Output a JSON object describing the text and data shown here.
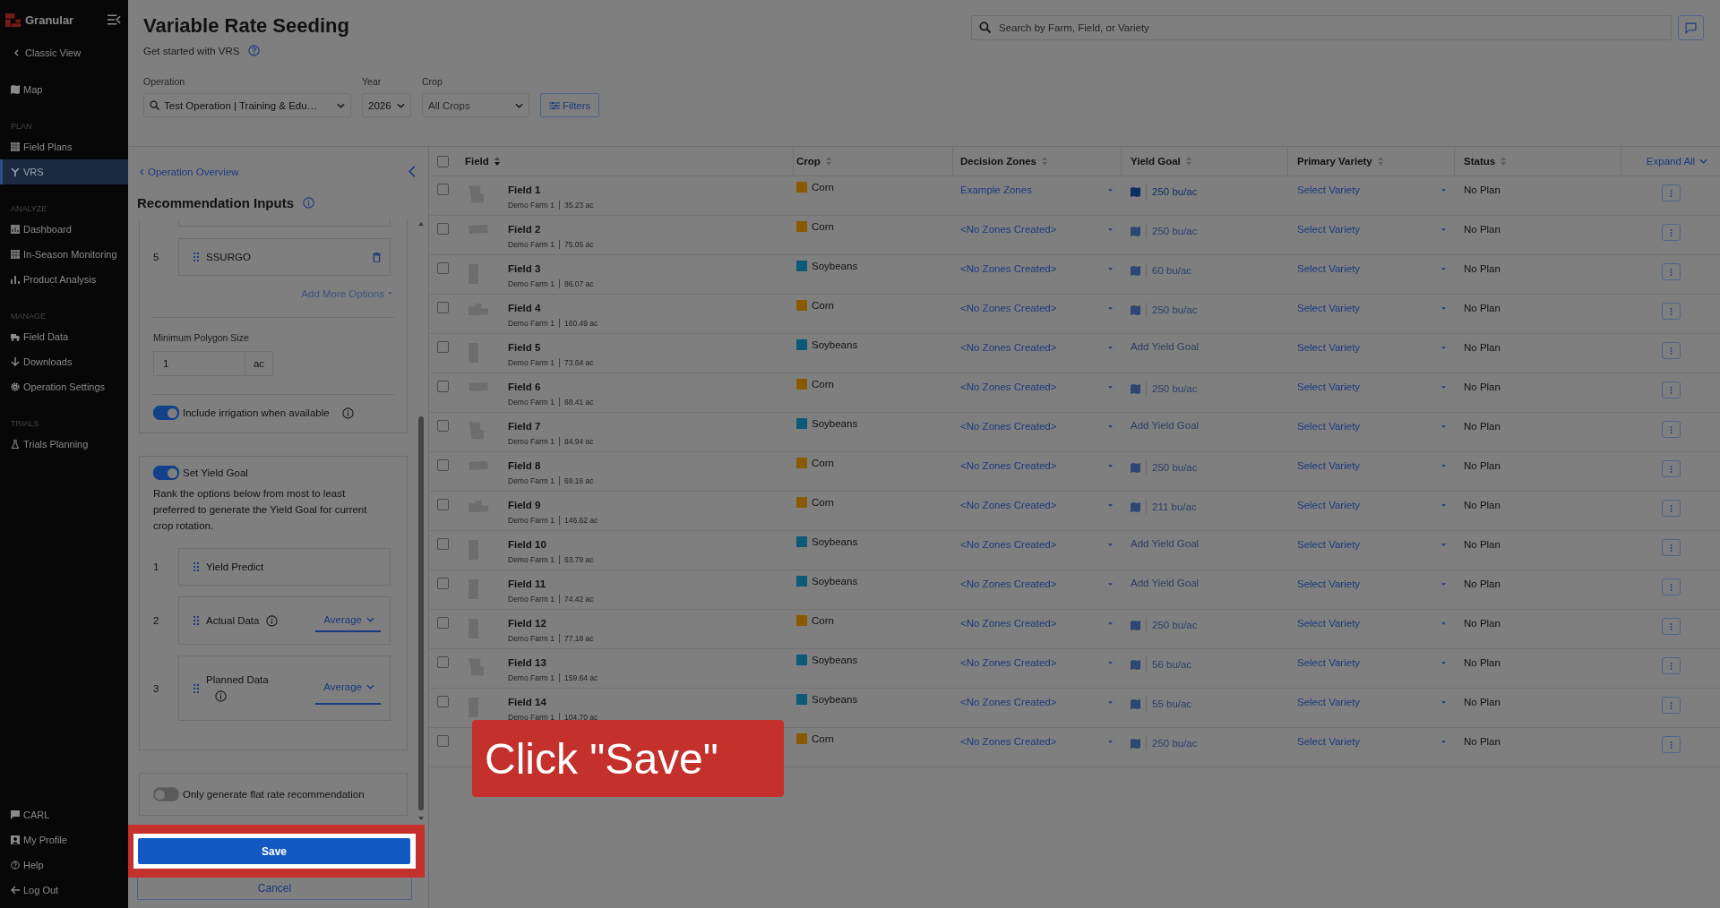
{
  "sidebar": {
    "brand": "Granular",
    "back_link": "Classic View",
    "groups": [
      {
        "items": [
          {
            "label": "Map",
            "selected": false
          }
        ]
      },
      {
        "heading": "PLAN",
        "items": [
          {
            "label": "Field Plans",
            "selected": false
          },
          {
            "label": "VRS",
            "selected": true
          }
        ]
      },
      {
        "heading": "ANALYZE",
        "items": [
          {
            "label": "Dashboard",
            "selected": false
          },
          {
            "label": "In-Season Monitoring",
            "selected": false
          },
          {
            "label": "Product Analysis",
            "selected": false
          }
        ]
      },
      {
        "heading": "MANAGE",
        "items": [
          {
            "label": "Field Data",
            "selected": false
          },
          {
            "label": "Downloads",
            "selected": false
          },
          {
            "label": "Operation Settings",
            "selected": false
          }
        ]
      },
      {
        "heading": "TRIALS",
        "items": [
          {
            "label": "Trials Planning",
            "selected": false
          }
        ]
      }
    ],
    "bottom_items": [
      "CARL",
      "My Profile",
      "Help",
      "Log Out"
    ]
  },
  "page": {
    "title": "Variable Rate Seeding",
    "subtitle": "Get started with VRS",
    "search_placeholder": "Search by Farm, Field, or Variety",
    "filters": [
      {
        "label": "Operation",
        "value": "Test Operation | Training & Edu…",
        "kind": "search"
      },
      {
        "label": "Year",
        "value": "2026",
        "kind": "select"
      },
      {
        "label": "Crop",
        "value": "All Crops",
        "kind": "select"
      }
    ],
    "filters_button": "Filters"
  },
  "panel": {
    "back_link": "Operation Overview",
    "title": "Recommendation Inputs",
    "sources": [
      {
        "rank": "5",
        "name": "SSURGO"
      }
    ],
    "add_more": "Add More Options",
    "min_polygon": {
      "label": "Minimum Polygon Size",
      "value": "1",
      "unit": "ac"
    },
    "irrigation": {
      "label": "Include irrigation when available",
      "on": true
    },
    "yield_goal": {
      "label": "Set Yield Goal",
      "on": true,
      "description": "Rank the options below from most to least preferred to generate the Yield Goal for current crop rotation.",
      "options": [
        {
          "rank": "1",
          "name": "Yield Predict"
        },
        {
          "rank": "2",
          "name": "Actual Data",
          "method": "Average",
          "kind": "inline"
        },
        {
          "rank": "3",
          "name": "Planned Data",
          "method": "Average",
          "kind": "stacked"
        }
      ]
    },
    "flat_rate": {
      "label": "Only generate flat rate recommendation",
      "on": false
    },
    "save": "Save",
    "cancel": "Cancel"
  },
  "table": {
    "all_selected": false,
    "columns": [
      {
        "label": "Field",
        "sorted": true
      },
      {
        "label": "Crop",
        "sorted": false
      },
      {
        "label": "Decision Zones",
        "sorted": false
      },
      {
        "label": "Yield Goal",
        "sorted": false
      },
      {
        "label": "Primary Variety",
        "sorted": false
      },
      {
        "label": "Status",
        "sorted": false
      }
    ],
    "expand_all": "Expand All",
    "rows": [
      {
        "selected": false,
        "field": "Field 1",
        "farm": "Demo Farm 1",
        "area": "35.23 ac",
        "crop": "Corn",
        "color": "#8a5a00",
        "zones": "Example Zones",
        "kind": "set",
        "yield_goal": "250 bu/ac",
        "variety": "Select Variety",
        "status": "No Plan"
      },
      {
        "selected": false,
        "field": "Field 2",
        "farm": "Demo Farm 1",
        "area": "75.05 ac",
        "crop": "Corn",
        "color": "#8a5a00",
        "zones": "<No Zones Created>",
        "kind": "default",
        "yield_goal": "250 bu/ac",
        "variety": "Select Variety",
        "status": "No Plan"
      },
      {
        "selected": false,
        "field": "Field 3",
        "farm": "Demo Farm 1",
        "area": "86.07 ac",
        "crop": "Soybeans",
        "color": "#0a5a78",
        "zones": "<No Zones Created>",
        "kind": "default",
        "yield_goal": "60 bu/ac",
        "variety": "Select Variety",
        "status": "No Plan"
      },
      {
        "selected": false,
        "field": "Field 4",
        "farm": "Demo Farm 1",
        "area": "160.49 ac",
        "crop": "Corn",
        "color": "#8a5a00",
        "zones": "<No Zones Created>",
        "kind": "default",
        "yield_goal": "250 bu/ac",
        "variety": "Select Variety",
        "status": "No Plan"
      },
      {
        "selected": false,
        "field": "Field 5",
        "farm": "Demo Farm 1",
        "area": "73.64 ac",
        "crop": "Soybeans",
        "color": "#0a5a78",
        "zones": "<No Zones Created>",
        "kind": "add",
        "yield_goal": "Add Yield Goal",
        "variety": "Select Variety",
        "status": "No Plan"
      },
      {
        "selected": false,
        "field": "Field 6",
        "farm": "Demo Farm 1",
        "area": "68.41 ac",
        "crop": "Corn",
        "color": "#8a5a00",
        "zones": "<No Zones Created>",
        "kind": "default",
        "yield_goal": "250 bu/ac",
        "variety": "Select Variety",
        "status": "No Plan"
      },
      {
        "selected": false,
        "field": "Field 7",
        "farm": "Demo Farm 1",
        "area": "84.94 ac",
        "crop": "Soybeans",
        "color": "#0a5a78",
        "zones": "<No Zones Created>",
        "kind": "add",
        "yield_goal": "Add Yield Goal",
        "variety": "Select Variety",
        "status": "No Plan"
      },
      {
        "selected": false,
        "field": "Field 8",
        "farm": "Demo Farm 1",
        "area": "69.16 ac",
        "crop": "Corn",
        "color": "#8a5a00",
        "zones": "<No Zones Created>",
        "kind": "default",
        "yield_goal": "250 bu/ac",
        "variety": "Select Variety",
        "status": "No Plan"
      },
      {
        "selected": false,
        "field": "Field 9",
        "farm": "Demo Farm 1",
        "area": "146.62 ac",
        "crop": "Corn",
        "color": "#8a5a00",
        "zones": "<No Zones Created>",
        "kind": "default",
        "yield_goal": "211 bu/ac",
        "variety": "Select Variety",
        "status": "No Plan"
      },
      {
        "selected": false,
        "field": "Field 10",
        "farm": "Demo Farm 1",
        "area": "63.79 ac",
        "crop": "Soybeans",
        "color": "#0a5a78",
        "zones": "<No Zones Created>",
        "kind": "add",
        "yield_goal": "Add Yield Goal",
        "variety": "Select Variety",
        "status": "No Plan"
      },
      {
        "selected": false,
        "field": "Field 11",
        "farm": "Demo Farm 1",
        "area": "74.42 ac",
        "crop": "Soybeans",
        "color": "#0a5a78",
        "zones": "<No Zones Created>",
        "kind": "add",
        "yield_goal": "Add Yield Goal",
        "variety": "Select Variety",
        "status": "No Plan"
      },
      {
        "selected": false,
        "field": "Field 12",
        "farm": "Demo Farm 1",
        "area": "77.18 ac",
        "crop": "Corn",
        "color": "#8a5a00",
        "zones": "<No Zones Created>",
        "kind": "default",
        "yield_goal": "250 bu/ac",
        "variety": "Select Variety",
        "status": "No Plan"
      },
      {
        "selected": false,
        "field": "Field 13",
        "farm": "Demo Farm 1",
        "area": "159.64 ac",
        "crop": "Soybeans",
        "color": "#0a5a78",
        "zones": "<No Zones Created>",
        "kind": "default",
        "yield_goal": "56 bu/ac",
        "variety": "Select Variety",
        "status": "No Plan"
      },
      {
        "selected": false,
        "field": "Field 14",
        "farm": "Demo Farm 1",
        "area": "104.70 ac",
        "crop": "Soybeans",
        "color": "#0a5a78",
        "zones": "<No Zones Created>",
        "kind": "default",
        "yield_goal": "55 bu/ac",
        "variety": "Select Variety",
        "status": "No Plan"
      },
      {
        "selected": false,
        "crop": "Corn",
        "color": "#8a5a00",
        "zones": "<No Zones Created>",
        "kind": "default",
        "yield_goal": "250 bu/ac",
        "variety": "Select Variety",
        "status": "No Plan"
      }
    ]
  },
  "callout": "Click \"Save\""
}
